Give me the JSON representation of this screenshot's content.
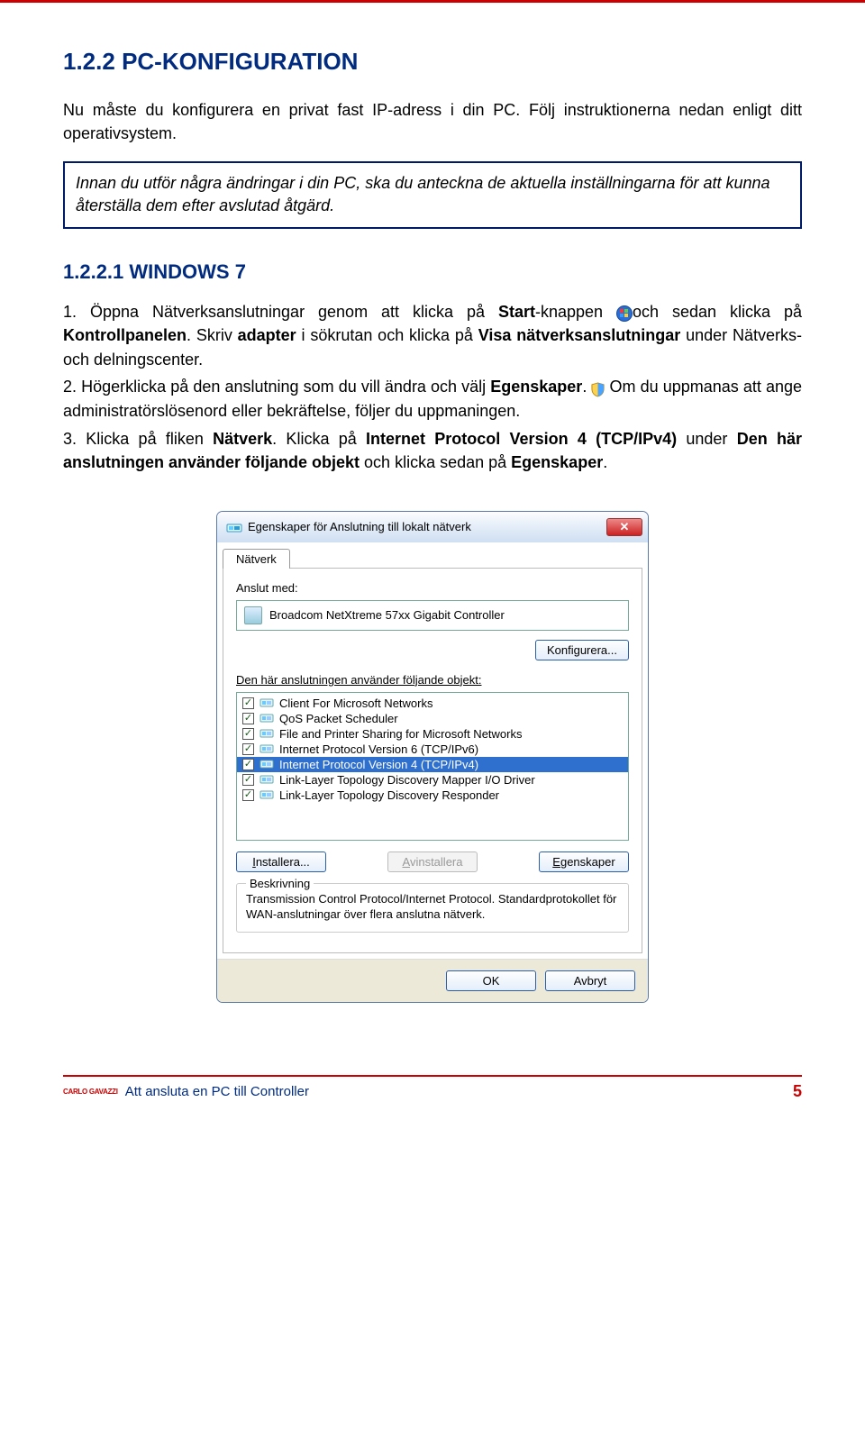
{
  "heading": {
    "num": "1.2.2 ",
    "titleA": "PC-",
    "titleB": "KONFIGURATION"
  },
  "intro": "Nu måste du konfigurera en privat fast IP-adress i din PC. Följ instruktionerna nedan enligt ditt operativsystem.",
  "note": "Innan du utför några ändringar i din PC, ska du anteckna de aktuella inställningarna för att kunna återställa dem efter avslutad åtgärd.",
  "sub": {
    "num": "1.2.2.1 ",
    "titleA": "W",
    "titleB": "INDOWS",
    "titleC": " 7"
  },
  "step1": {
    "p1": "1. Öppna Nätverksanslutningar genom att klicka på ",
    "b1": "Start",
    "p2": "-knappen ",
    "p3": "och sedan klicka på ",
    "b2": "Kontrollpanelen",
    "p4": ". Skriv ",
    "b3": "adapter",
    "p5": " i sökrutan och klicka på ",
    "b4": "Visa nätverksanslutningar",
    "p6": " under Nätverks- och delningscenter."
  },
  "step2": {
    "p1": "2. Högerklicka på den anslutning som du vill ändra och välj ",
    "b1": "Egenskaper",
    "p2": ". ",
    "p3": " Om du uppmanas att ange administratörslösenord eller bekräftelse, följer du uppmaningen."
  },
  "step3": {
    "p1": "3. Klicka på fliken ",
    "b1": "Nätverk",
    "p2": ". Klicka på ",
    "b2": "Internet Protocol Version 4 (TCP/IPv4)",
    "p3": " under ",
    "b3": "Den här anslutningen använder följande objekt",
    "p4": " och klicka sedan på ",
    "b4": "Egenskaper",
    "p5": "."
  },
  "dialog": {
    "title": "Egenskaper för Anslutning till lokalt nätverk",
    "tab": "Nätverk",
    "connect_with": "Anslut med:",
    "adapter": "Broadcom NetXtreme 57xx Gigabit Controller",
    "configure": "Konfigurera...",
    "uses_label": "Den här anslutningen använder följande objekt:",
    "items": [
      {
        "label": "Client For Microsoft Networks",
        "checked": true,
        "selected": false
      },
      {
        "label": "QoS Packet Scheduler",
        "checked": true,
        "selected": false
      },
      {
        "label": "File and Printer Sharing for Microsoft Networks",
        "checked": true,
        "selected": false
      },
      {
        "label": "Internet Protocol Version 6 (TCP/IPv6)",
        "checked": true,
        "selected": false
      },
      {
        "label": "Internet Protocol Version 4 (TCP/IPv4)",
        "checked": true,
        "selected": true
      },
      {
        "label": "Link-Layer Topology Discovery Mapper I/O Driver",
        "checked": true,
        "selected": false
      },
      {
        "label": "Link-Layer Topology Discovery Responder",
        "checked": true,
        "selected": false
      }
    ],
    "install": "Installera...",
    "uninstall": "Avinstallera",
    "properties": "Egenskaper",
    "desc_title": "Beskrivning",
    "desc": "Transmission Control Protocol/Internet Protocol. Standardprotokollet för WAN-anslutningar över flera anslutna nätverk.",
    "ok": "OK",
    "cancel": "Avbryt"
  },
  "footer": {
    "left": "Att ansluta en PC till Controller",
    "right": "5",
    "logo": "CARLO GAVAZZI"
  }
}
